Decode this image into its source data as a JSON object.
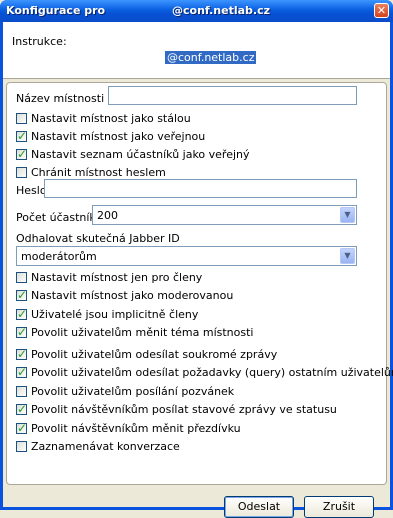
{
  "window": {
    "title": "Konfigurace pro",
    "room": "@conf.netlab.cz",
    "close_glyph": "✕"
  },
  "instructions": {
    "label": "Instrukce:",
    "link": "@conf.netlab.cz"
  },
  "form": {
    "room_name_label": "Název místnosti",
    "room_name_value": "",
    "checks_a": [
      {
        "label": "Nastavit místnost jako stálou",
        "checked": false
      },
      {
        "label": "Nastavit místnost jako veřejnou",
        "checked": true
      },
      {
        "label": "Nastavit seznam účastníků jako veřejný",
        "checked": true
      },
      {
        "label": "Chránit místnost heslem",
        "checked": false
      }
    ],
    "password_label": "Heslo",
    "password_value": "",
    "participants_label": "Počet účastníků",
    "participants_value": "200",
    "jid_label": "Odhalovat skutečná Jabber ID",
    "jid_value": "moderátorům",
    "checks_b": [
      {
        "label": "Nastavit místnost jen pro členy",
        "checked": false
      },
      {
        "label": "Nastavit místnost jako moderovanou",
        "checked": true
      },
      {
        "label": "Uživatelé jsou implicitně členy",
        "checked": true
      },
      {
        "label": "Povolit uživatelům měnit téma místnosti",
        "checked": true
      },
      {
        "label": "Povolit uživatelům odesílat soukromé zprávy",
        "checked": true
      },
      {
        "label": "Povolit uživatelům odesílat požadavky (query) ostatním uživatelům",
        "checked": true
      },
      {
        "label": "Povolit uživatelům posílání pozvánek",
        "checked": false
      },
      {
        "label": "Povolit návštěvníkům posílat stavové zprávy ve statusu",
        "checked": true
      },
      {
        "label": "Povolit návštěvníkům měnit přezdívku",
        "checked": true
      },
      {
        "label": "Zaznamenávat konverzace",
        "checked": false
      }
    ]
  },
  "buttons": {
    "send": "Odeslat",
    "cancel": "Zrušit"
  }
}
